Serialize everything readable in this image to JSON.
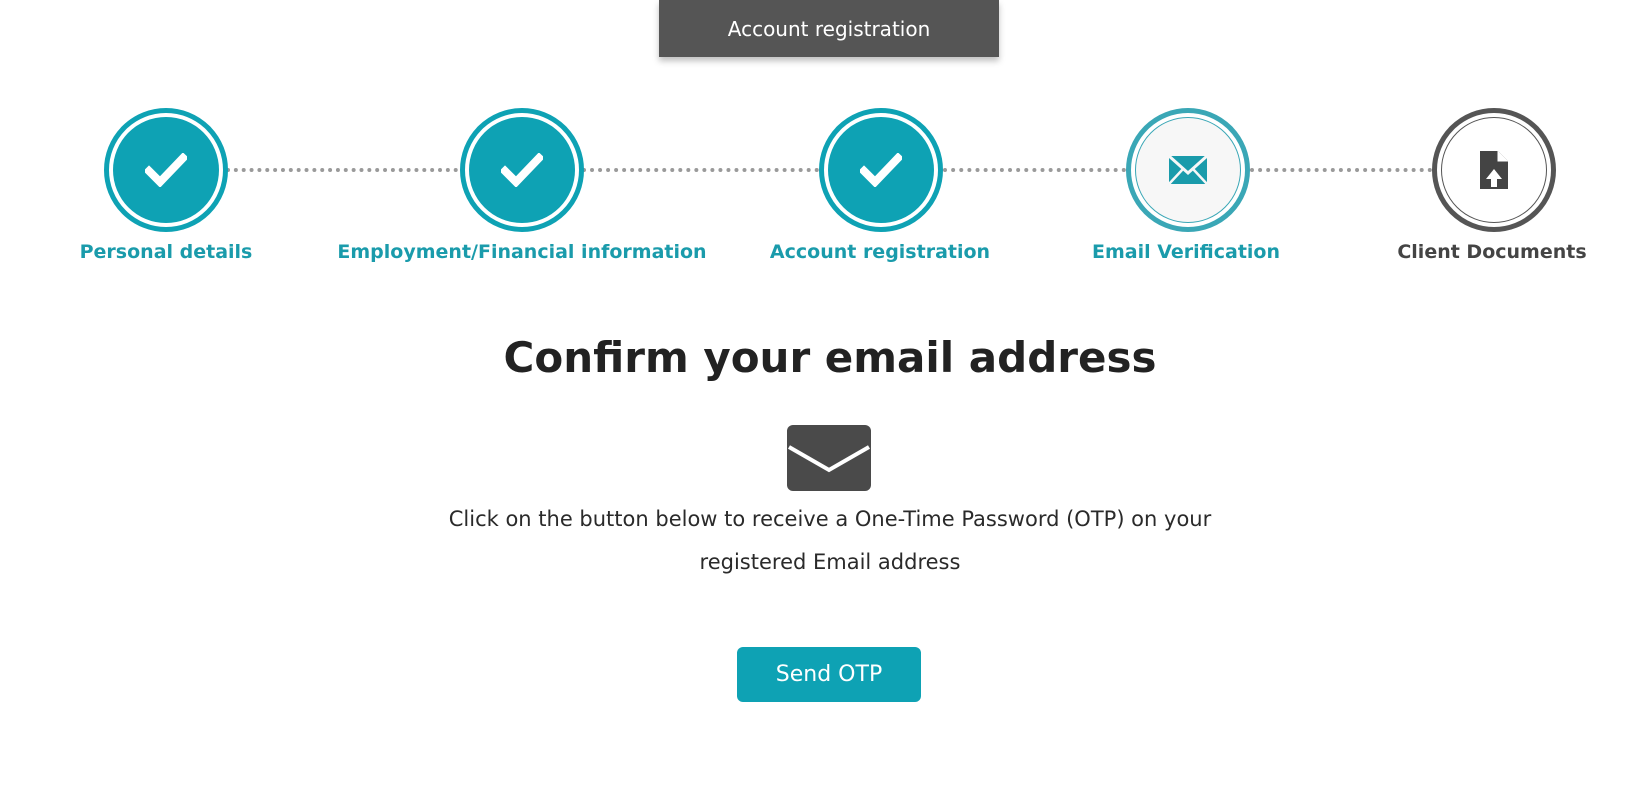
{
  "header": {
    "tab_title": "Account registration"
  },
  "steps": [
    {
      "label": "Personal details",
      "state": "completed",
      "icon": "check-icon"
    },
    {
      "label": "Employment/Financial information",
      "state": "completed",
      "icon": "check-icon"
    },
    {
      "label": "Account registration",
      "state": "completed",
      "icon": "check-icon"
    },
    {
      "label": "Email Verification",
      "state": "current",
      "icon": "envelope-icon"
    },
    {
      "label": "Client Documents",
      "state": "pending",
      "icon": "file-upload-icon"
    }
  ],
  "main": {
    "heading": "Confirm your email address",
    "icon": "envelope-icon",
    "description": "Click on the button below to receive a One-Time Password (OTP) on your registered Email address",
    "send_button_label": "Send OTP"
  },
  "colors": {
    "accent": "#0ea2b4",
    "tab_background": "#555555",
    "pending": "#555555",
    "label_accent": "#1a9bab"
  }
}
